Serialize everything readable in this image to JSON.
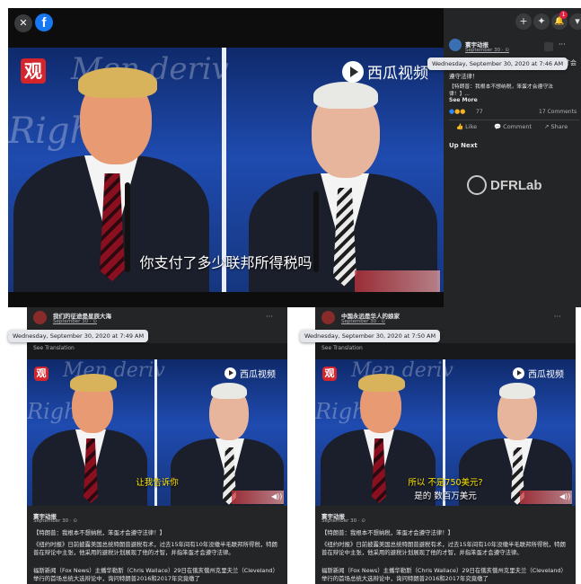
{
  "top": {
    "close_glyph": "✕",
    "fb_glyph": "f",
    "watermark_guan": "观",
    "watermark_xigua": "西瓜视频",
    "subtitle": "你支付了多少联邦所得税吗",
    "backdrop_script": [
      "Men deriv",
      "Right"
    ],
    "header_icons": {
      "plus": "+",
      "messenger": "✦",
      "bell": "🔔",
      "caret": "▾",
      "badge": "1"
    },
    "post": {
      "page_name": "寰宇动报",
      "time": "September 30 · ⊙",
      "tooltip": "Wednesday, September 30, 2020 at 7:46 AM",
      "title_overflow": "笨蛋才会",
      "line1": "遵守法律！",
      "line2": "【特朗普：我根本不想纳税，笨蛋才会遵守法",
      "line3": "律！】...",
      "see_more": "See More",
      "reaction_count": "77",
      "comments": "17 Comments",
      "like": "Like",
      "comment": "Comment",
      "share": "Share",
      "up_next": "Up Next"
    },
    "watermark_text": "DFRLab"
  },
  "posts": [
    {
      "page_name": "我们的征途是星辰大海",
      "time": "September 30 · ⊙",
      "tooltip": "Wednesday, September 30, 2020 at 7:49 AM",
      "see_translation": "See Translation",
      "more": "···",
      "subtitle1": "让我告诉你",
      "subtitle2": "",
      "shared_name": "寰宇动报",
      "shared_time": "September 30 · ⊙",
      "p1": "【特朗普：我根本不想纳税，笨蛋才会遵守法律！】",
      "p2": "《纽约时报》日前披露美国总统特朗普避税有术，过去15年间有10年没缴半毛联邦所得税，特朗普在辩论中主张，他采用的避税计划展现了他的才智，并指笨蛋才会遵守法律。",
      "p3": "福斯新闻（Fox News）主播华勒斯（Chris Wallace）29日在俄亥俄州克里夫兰（Cleveland）举行的首场总统大选辩论中，询问特朗普2016和2017年究竟缴了"
    },
    {
      "page_name": "中国永远是华人的娘家",
      "time": "September 30 · ⊙",
      "tooltip": "Wednesday, September 30, 2020 at 7:50 AM",
      "see_translation": "See Translation",
      "more": "···",
      "subtitle1": "所以 不是750美元?",
      "subtitle2": "是的 数百万美元",
      "shared_name": "寰宇动报",
      "shared_time": "September 30 · ⊙",
      "p1": "【特朗普：我根本不想纳税，笨蛋才会遵守法律！】",
      "p2": "《纽约时报》日前披露美国总统特朗普避税有术，过去15年间有10年没缴半毛联邦所得税，特朗普在辩论中主张，他采用的避税计划展现了他的才智，并指笨蛋才会遵守法律。",
      "p3": "福斯新闻（Fox News）主播华勒斯（Chris Wallace）29日在俄亥俄州克里夫兰（Cleveland）举行的首场总统大选辩论中，询问特朗普2016和2017年究竟缴了"
    }
  ],
  "colors": {
    "fb_blue": "#1877f2",
    "dark_bg": "#18191a",
    "panel": "#242526",
    "link": "#2d88ff",
    "subtitle_yellow": "#ffe600"
  }
}
